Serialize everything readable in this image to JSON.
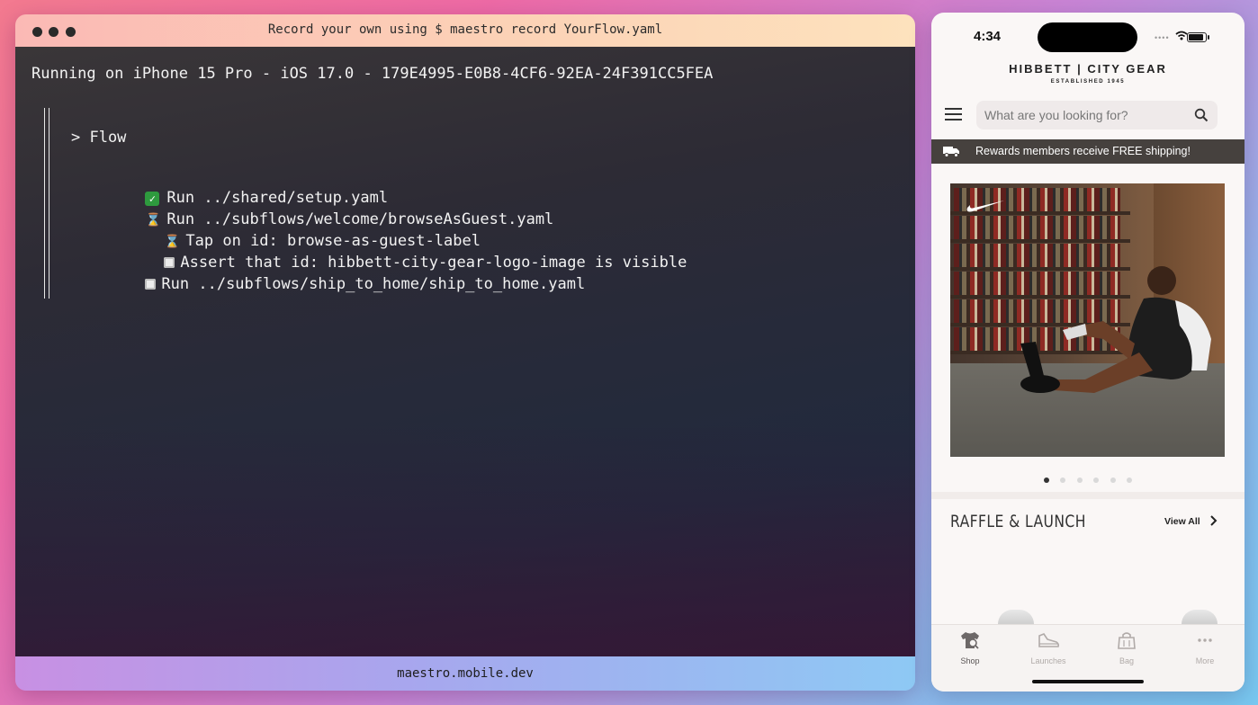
{
  "terminal": {
    "title": "Record your own using $ maestro record YourFlow.yaml",
    "device_line": "Running on iPhone 15 Pro - iOS 17.0 - 179E4995-E0B8-4CF6-92EA-24F391CC5FEA",
    "flow_header": "> Flow",
    "steps": [
      {
        "status": "completed",
        "status_icon": "check-icon",
        "text": "Run ../shared/setup.yaml"
      },
      {
        "status": "running",
        "status_icon": "hourglass-icon",
        "text": "Run ../subflows/welcome/browseAsGuest.yaml"
      },
      {
        "status": "running",
        "status_icon": "hourglass-icon",
        "text": "Tap on id: browse-as-guest-label"
      },
      {
        "status": "pending",
        "status_icon": "pending-icon",
        "text": "Assert that id: hibbett-city-gear-logo-image is visible"
      },
      {
        "status": "pending",
        "status_icon": "pending-icon",
        "text": "Run ../subflows/ship_to_home/ship_to_home.yaml"
      }
    ],
    "footer": "maestro.mobile.dev"
  },
  "phone": {
    "status_time": "4:34",
    "logo_main": "HIBBETT | CITY GEAR",
    "logo_sub": "ESTABLISHED 1945",
    "search_placeholder": "What are you looking for?",
    "promo_text": "Rewards members receive FREE shipping!",
    "carousel_active_index": 0,
    "carousel_count": 6,
    "section_title": "RAFFLE & LAUNCH",
    "view_all": "View All",
    "tabs": [
      {
        "label": "Shop",
        "icon": "shop-icon",
        "active": true
      },
      {
        "label": "Launches",
        "icon": "sneaker-icon",
        "active": false
      },
      {
        "label": "Bag",
        "icon": "bag-icon",
        "active": false
      },
      {
        "label": "More",
        "icon": "more-icon",
        "active": false
      }
    ]
  },
  "colors": {
    "terminal_bg": "#2d2b35",
    "promo_bar": "#46413e",
    "check_green": "#2e9a3e"
  }
}
